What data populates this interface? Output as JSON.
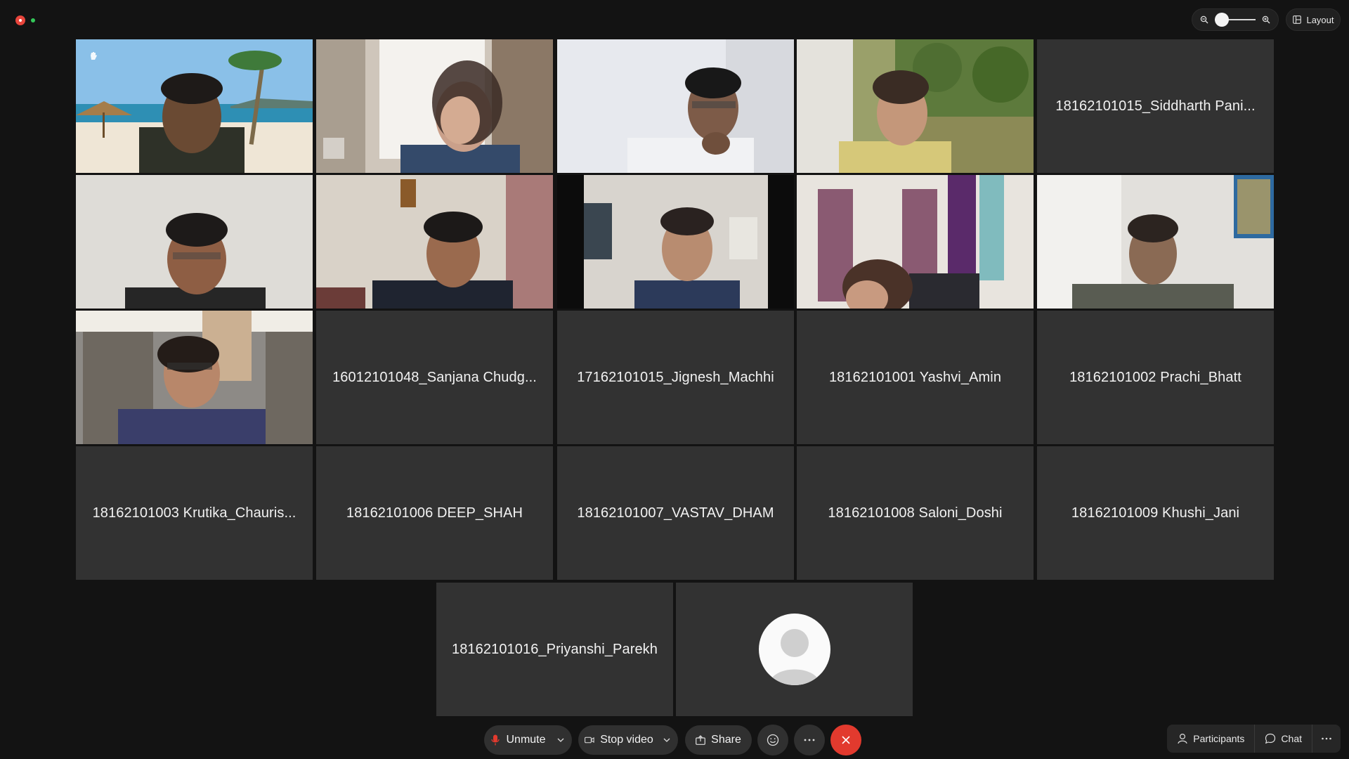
{
  "top_bar": {
    "layout_label": "Layout",
    "zoom_level": 0.05
  },
  "participants": [
    {
      "name": "",
      "video": true
    },
    {
      "name": "",
      "video": true
    },
    {
      "name": "",
      "video": true
    },
    {
      "name": "",
      "video": true
    },
    {
      "name": "18162101015_Siddharth Pani...",
      "video": false
    },
    {
      "name": "",
      "video": true
    },
    {
      "name": "",
      "video": true
    },
    {
      "name": "",
      "video": true
    },
    {
      "name": "",
      "video": true
    },
    {
      "name": "",
      "video": true
    },
    {
      "name": "",
      "video": true
    },
    {
      "name": "16012101048_Sanjana Chudg...",
      "video": false
    },
    {
      "name": "17162101015_Jignesh_Machhi",
      "video": false
    },
    {
      "name": "18162101001 Yashvi_Amin",
      "video": false
    },
    {
      "name": "18162101002 Prachi_Bhatt",
      "video": false
    },
    {
      "name": "18162101003 Krutika_Chauris...",
      "video": false
    },
    {
      "name": "18162101006 DEEP_SHAH",
      "video": false
    },
    {
      "name": "18162101007_VASTAV_DHAM",
      "video": false
    },
    {
      "name": "18162101008 Saloni_Doshi",
      "video": false
    },
    {
      "name": "18162101009 Khushi_Jani",
      "video": false
    },
    {
      "name": "18162101016_Priyanshi_Parekh",
      "video": false
    },
    {
      "name": "",
      "video": false,
      "avatar": true
    }
  ],
  "toolbar": {
    "unmute_label": "Unmute",
    "stop_video_label": "Stop video",
    "share_label": "Share",
    "participants_label": "Participants",
    "chat_label": "Chat"
  },
  "colors": {
    "background": "#131313",
    "tile": "#323232",
    "leave": "#e23a2e",
    "mic_muted": "#e23a2e",
    "recording": "#e8453c",
    "secure": "#34c759"
  }
}
